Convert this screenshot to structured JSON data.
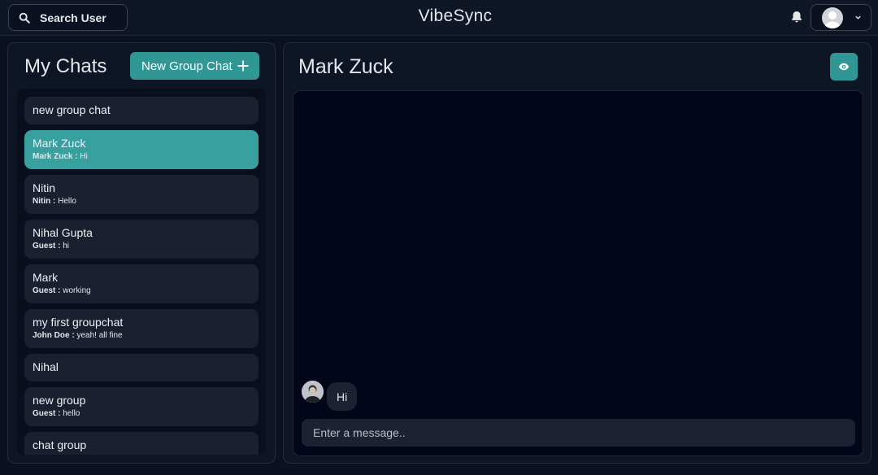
{
  "header": {
    "search_label": "Search User",
    "app_title": "VibeSync"
  },
  "sidebar": {
    "title": "My Chats",
    "new_group_label": "New Group Chat",
    "chats": [
      {
        "name": "new group chat",
        "sender": "",
        "message": ""
      },
      {
        "name": "Mark Zuck",
        "sender": "Mark Zuck :",
        "message": "Hi",
        "active": true
      },
      {
        "name": "Nitin",
        "sender": "Nitin :",
        "message": "Hello"
      },
      {
        "name": "Nihal Gupta",
        "sender": "Guest :",
        "message": "hi"
      },
      {
        "name": "Mark",
        "sender": "Guest :",
        "message": "working"
      },
      {
        "name": "my first groupchat",
        "sender": "John Doe :",
        "message": "yeah! all fine"
      },
      {
        "name": "Nihal",
        "sender": "",
        "message": ""
      },
      {
        "name": "new group",
        "sender": "Guest :",
        "message": "hello"
      },
      {
        "name": "chat group",
        "sender": "",
        "message": ""
      }
    ]
  },
  "chat": {
    "title": "Mark Zuck",
    "messages": [
      {
        "text": "Hi"
      }
    ],
    "input_placeholder": "Enter a message.."
  },
  "colors": {
    "accent": "#319795",
    "active_chat": "#38a19f",
    "background": "#0b1120"
  },
  "icons": [
    "search-icon",
    "bell-icon",
    "user-avatar-icon",
    "chevron-down-icon",
    "plus-icon",
    "eye-icon"
  ]
}
